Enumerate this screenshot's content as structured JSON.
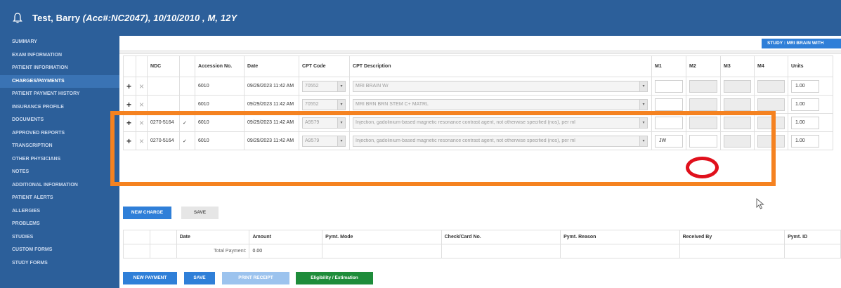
{
  "header": {
    "title_name": "Test, Barry ",
    "title_rest": "(Acc#:NC2047), 10/10/2010 , M, 12Y"
  },
  "sidebar": {
    "items": [
      {
        "label": "SUMMARY"
      },
      {
        "label": "EXAM INFORMATION"
      },
      {
        "label": "PATIENT INFORMATION"
      },
      {
        "label": "CHARGES/PAYMENTS",
        "active": true
      },
      {
        "label": "PATIENT PAYMENT HISTORY"
      },
      {
        "label": "INSURANCE PROFILE"
      },
      {
        "label": "DOCUMENTS"
      },
      {
        "label": "APPROVED REPORTS"
      },
      {
        "label": "TRANSCRIPTION"
      },
      {
        "label": "OTHER PHYSICIANS"
      },
      {
        "label": "NOTES"
      },
      {
        "label": "ADDITIONAL INFORMATION"
      },
      {
        "label": "PATIENT ALERTS"
      },
      {
        "label": "ALLERGIES"
      },
      {
        "label": "PROBLEMS"
      },
      {
        "label": "STUDIES"
      },
      {
        "label": "CUSTOM FORMS"
      },
      {
        "label": "STUDY FORMS"
      }
    ]
  },
  "study_badge": "STUDY : MRI BRAIN WITH",
  "charges": {
    "headers": [
      "",
      "",
      "NDC",
      "",
      "Accession No.",
      "Date",
      "CPT Code",
      "CPT Description",
      "M1",
      "M2",
      "M3",
      "M4",
      "Units"
    ],
    "rows": [
      {
        "ndc": "",
        "accession": "6010",
        "date": "09/29/2023 11:42 AM",
        "cpt": "70552",
        "desc": "MRI BRAIN W/",
        "m1": "",
        "units": "1.00"
      },
      {
        "ndc": "",
        "accession": "6010",
        "date": "09/29/2023 11:42 AM",
        "cpt": "70552",
        "desc": "MRI BRN BRN STEM C+ MATRL",
        "m1": "",
        "units": "1.00"
      },
      {
        "ndc": "0270-5164",
        "accession": "6010",
        "date": "09/29/2023 11:42 AM",
        "cpt": "A9579",
        "desc": "Injection, gadolinium-based magnetic resonance contrast agent, not otherwise specified (nos), per ml",
        "m1": "",
        "units": "1.00"
      },
      {
        "ndc": "0270-5164",
        "accession": "6010",
        "date": "09/29/2023 11:42 AM",
        "cpt": "A9579",
        "desc": "Injection, gadolinium-based magnetic resonance contrast agent, not otherwise specified (nos), per ml",
        "m1": "JW",
        "units": "1.00"
      }
    ]
  },
  "buttons": {
    "new_charge": "NEW CHARGE",
    "save": "SAVE",
    "new_payment": "NEW PAYMENT",
    "save2": "SAVE",
    "print_receipt": "PRINT RECEIPT",
    "eligibility": "Eligibility / Estimation"
  },
  "payments": {
    "headers": [
      "",
      "",
      "Date",
      "Amount",
      "Pymt. Mode",
      "Check/Card No.",
      "Pymt. Reason",
      "Received By",
      "Pymt. ID"
    ],
    "total_label": "Total Payment:",
    "total_value": "0.00"
  },
  "colors": {
    "header_bg": "#2c5f9a",
    "accent_blue": "#2f7fd8",
    "annotation_orange": "#f58220",
    "annotation_red": "#e0101c",
    "eligibility_green": "#1e8c3a"
  }
}
